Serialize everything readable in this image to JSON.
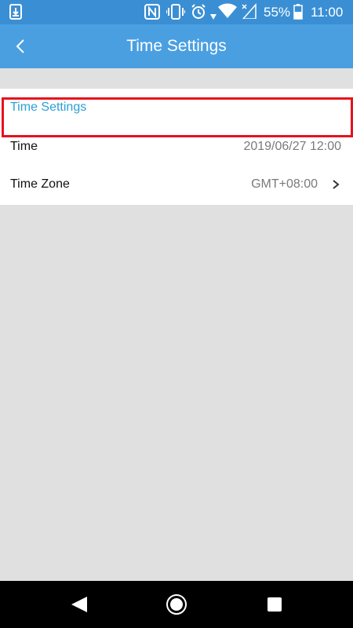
{
  "status_bar": {
    "battery_percent": "55%",
    "time": "11:00"
  },
  "app_bar": {
    "title": "Time Settings",
    "back_icon": "chevron-left-icon",
    "background": "#4a9fe1"
  },
  "section": {
    "header": "Time Settings",
    "header_color": "#2b9fd6",
    "rows": [
      {
        "label": "Time",
        "value": "2019/06/27 12:00"
      },
      {
        "label": "Time Zone",
        "value": "GMT+08:00",
        "icon": "chevron-right-icon"
      }
    ]
  },
  "highlight": {
    "target": "Time Zone",
    "color": "#e8111d"
  },
  "nav_bar": {
    "buttons": [
      "back-triangle-icon",
      "home-circle-icon",
      "recents-square-icon"
    ]
  }
}
